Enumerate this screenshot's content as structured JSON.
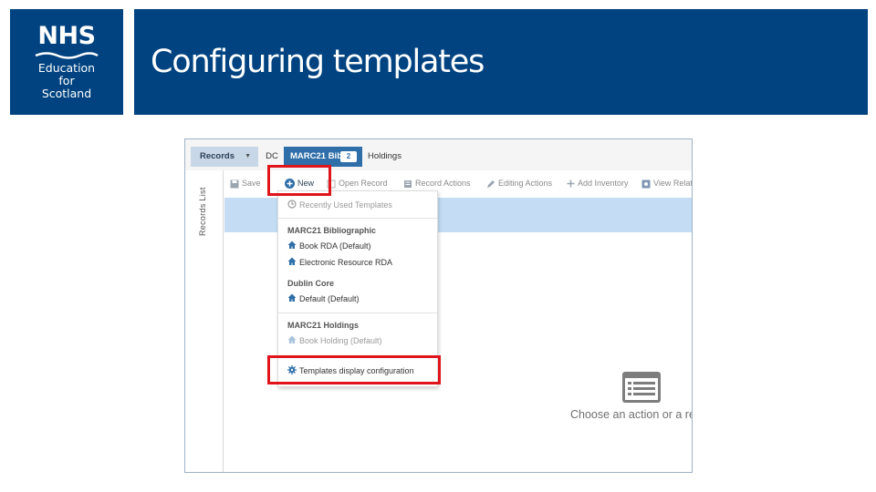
{
  "slide": {
    "logo": {
      "line1": "NHS",
      "line2": "Education",
      "line3": "for",
      "line4": "Scotland"
    },
    "title": "Configuring templates"
  },
  "app": {
    "tabs": {
      "records": "Records",
      "dc": "DC",
      "marc": "MARC21 Bib",
      "marc_badge": "2",
      "holdings": "Holdings"
    },
    "sidebar_label": "Records List",
    "toolbar": {
      "save": "Save",
      "new": "New",
      "open": "Open Record",
      "record_actions": "Record Actions",
      "editing_actions": "Editing Actions",
      "add_inventory": "Add Inventory",
      "view": "View Relat"
    },
    "menu": {
      "recent": "Recently Used Templates",
      "group1": "MARC21 Bibliographic",
      "item_book_rda": "Book RDA (Default)",
      "item_eres_rda": "Electronic Resource RDA",
      "group2": "Dublin Core",
      "item_default": "Default (Default)",
      "group3": "MARC21 Holdings",
      "item_book_holding": "Book Holding (Default)",
      "config": "Templates display configuration"
    },
    "empty_state": "Choose an action or a re"
  },
  "colors": {
    "nhs_blue": "#004380",
    "tab_active": "#2f6fa9",
    "highlight_red": "#e0141b",
    "band_blue": "#c4ddf4"
  }
}
